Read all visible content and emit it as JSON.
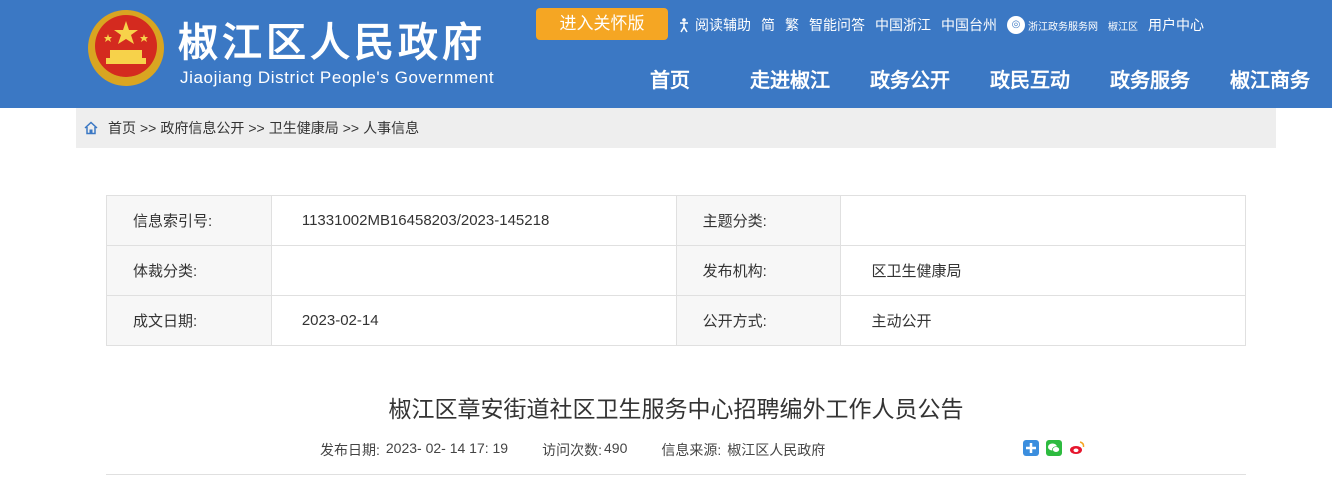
{
  "header": {
    "title_cn": "椒江区人民政府",
    "title_en": "Jiaojiang District People's Government",
    "care_button": "进入关怀版",
    "toplinks": {
      "reading_aid": "阅读辅助",
      "simplified": "简",
      "traditional": "繁",
      "smart_qa": "智能问答",
      "china_zhejiang": "中国浙江",
      "china_taizhou": "中国台州",
      "zj_service": "浙江政务服务网",
      "jiaojiang_small": "椒江区",
      "user_center": "用户中心"
    },
    "nav": [
      "首页",
      "走进椒江",
      "政务公开",
      "政民互动",
      "政务服务",
      "椒江商务"
    ]
  },
  "breadcrumb": {
    "home": "首页",
    "sep": ">>",
    "items": [
      "政府信息公开",
      "卫生健康局",
      "人事信息"
    ]
  },
  "meta": {
    "index_label": "信息索引号:",
    "index_value": "11331002MB16458203/2023-145218",
    "topic_label": "主题分类:",
    "topic_value": "",
    "genre_label": "体裁分类:",
    "genre_value": "",
    "publisher_label": "发布机构:",
    "publisher_value": "区卫生健康局",
    "date_label": "成文日期:",
    "date_value": "2023-02-14",
    "mode_label": "公开方式:",
    "mode_value": "主动公开"
  },
  "article": {
    "title": "椒江区章安街道社区卫生服务中心招聘编外工作人员公告",
    "publish_label": "发布日期:",
    "publish_value": "2023- 02- 14 17: 19",
    "visits_label": "访问次数:",
    "visits_value": "490",
    "source_label": "信息来源:",
    "source_value": "椒江区人民政府"
  },
  "colors": {
    "header_bg": "#3b78c4",
    "care_button": "#f5a623",
    "wechat": "#2dbb3f",
    "weibo": "#e6162d",
    "share_plus": "#3b8ede"
  }
}
